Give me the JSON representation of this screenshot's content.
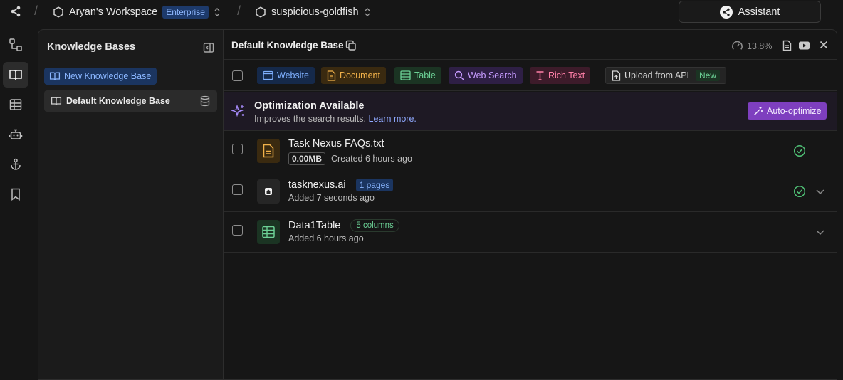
{
  "topbar": {
    "workspace_name": "Aryan's Workspace",
    "plan_badge": "Enterprise",
    "project_name": "suspicious-goldfish",
    "assistant_label": "Assistant"
  },
  "rail": [
    "flow-icon",
    "book-open-icon",
    "table-icon",
    "bot-icon",
    "anchor-icon",
    "bookmark-icon"
  ],
  "sidebar": {
    "title": "Knowledge Bases",
    "new_button": "New Knowledge Base",
    "items": [
      {
        "label": "Default Knowledge Base"
      }
    ]
  },
  "main": {
    "title": "Default Knowledge Base",
    "usage": "13.8%",
    "toolbar": {
      "website": "Website",
      "document": "Document",
      "table": "Table",
      "web_search": "Web Search",
      "rich_text": "Rich Text",
      "upload_api": "Upload from API",
      "new_tag": "New"
    },
    "optimization": {
      "title": "Optimization Available",
      "description": "Improves the search results.",
      "link": "Learn more.",
      "button": "Auto-optimize"
    },
    "sources": [
      {
        "name": "Task Nexus FAQs.txt",
        "size": "0.00MB",
        "meta": "Created 6 hours ago",
        "status": "ready"
      },
      {
        "name": "tasknexus.ai",
        "tag": "1 pages",
        "meta": "Added 7 seconds ago",
        "status": "ready"
      },
      {
        "name": "Data1Table",
        "tag": "5 columns",
        "meta": "Added 6 hours ago"
      }
    ]
  },
  "colors": {
    "accent_blue": "#8ab6ff",
    "document_amber": "#f2b24a",
    "table_green": "#6cd196",
    "search_purple": "#c79cff",
    "richtext_pink": "#ff7fa8",
    "optimize_purple": "#7e3fbf",
    "status_green": "#4fbf75"
  }
}
